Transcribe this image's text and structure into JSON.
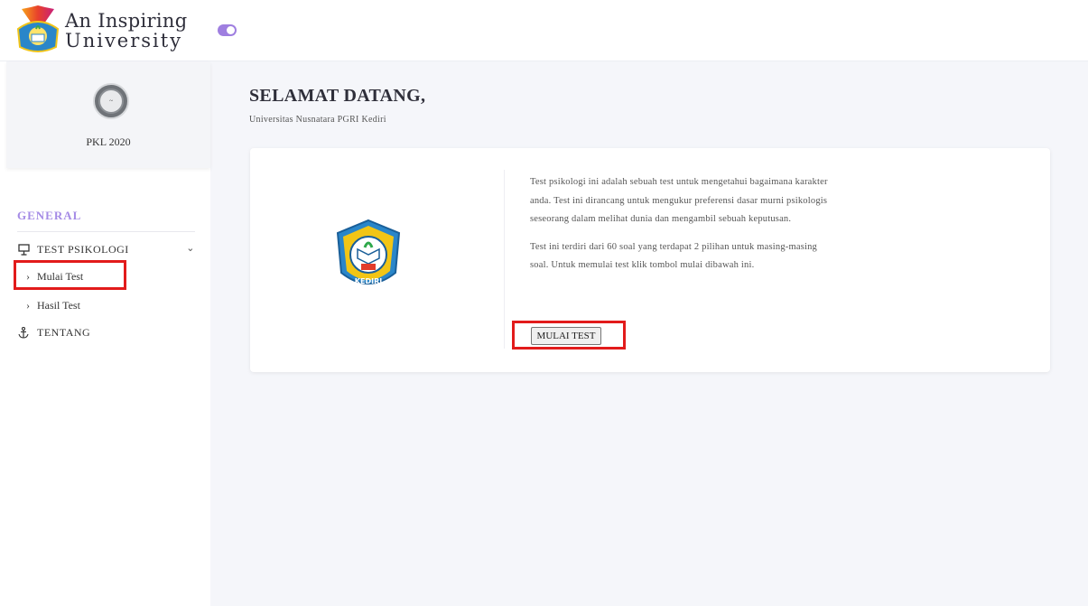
{
  "brand": {
    "line1": "An Inspiring",
    "line2": "University"
  },
  "sidebar": {
    "profile_name": "PKL 2020",
    "section_title": "GENERAL",
    "menu": {
      "test_psikologi": "TEST PSIKOLOGI",
      "mulai_test": "Mulai Test",
      "hasil_test": "Hasil Test",
      "tentang": "TENTANG"
    }
  },
  "main": {
    "title": "SELAMAT DATANG,",
    "subtitle": "Universitas Nusnatara PGRI Kediri",
    "card": {
      "paragraph1": "Test psikologi ini adalah sebuah test untuk mengetahui bagaimana karakter anda. Test ini dirancang untuk mengukur preferensi dasar murni psikologis seseorang dalam melihat dunia dan mengambil sebuah keputusan.",
      "paragraph2": "Test ini terdiri dari 60 soal yang terdapat 2 pilihan untuk masing-masing soal. Untuk memulai test klik tombol mulai dibawah ini.",
      "button_label": "MULAI TEST",
      "logo_text": "KEDIRI"
    }
  },
  "colors": {
    "accent": "#a58be6",
    "toggle": "#9f7fe0",
    "highlight": "#e21b1b",
    "background": "#f5f6fa"
  },
  "icons": {
    "brand_logo": "university-seal-icon",
    "toggle": "toggle-switch-icon",
    "test_psikologi": "presentation-board-icon",
    "tentang": "anchor-icon",
    "expand": "chevron-down-icon",
    "sub_arrow": "chevron-right-icon"
  }
}
